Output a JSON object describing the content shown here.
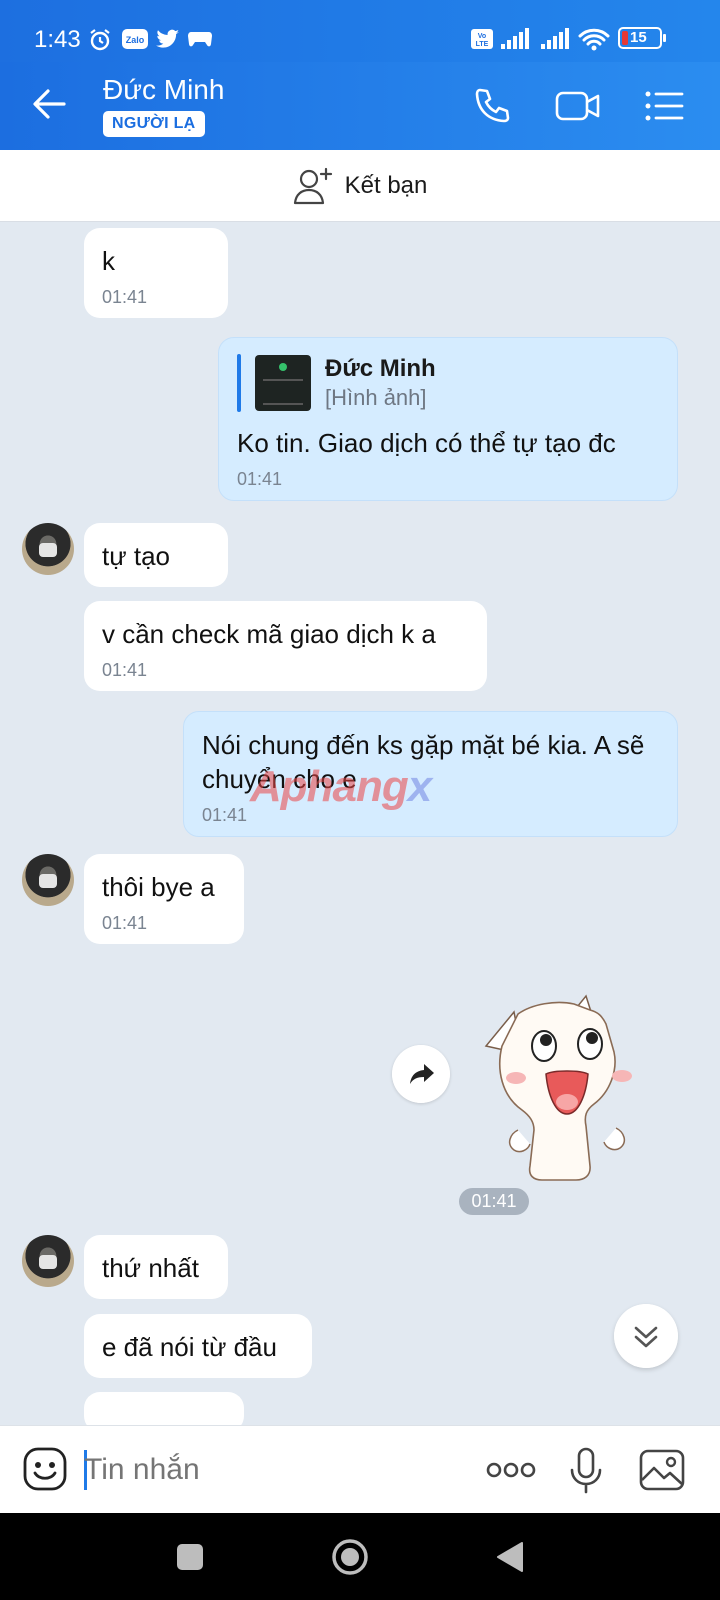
{
  "status_bar": {
    "time": "1:43",
    "battery": "15",
    "icons": [
      "alarm-icon",
      "zalo-icon",
      "twitter-icon",
      "game-icon",
      "volte-icon",
      "signal-icon",
      "signal-icon",
      "wifi-icon",
      "battery-icon"
    ]
  },
  "header": {
    "contact_name": "Đức Minh",
    "badge": "NGƯỜI LẠ",
    "icons": [
      "back-arrow-icon",
      "phone-icon",
      "video-call-icon",
      "menu-list-icon"
    ]
  },
  "add_friend": {
    "label": "Kết bạn",
    "icon": "add-user-icon"
  },
  "messages": [
    {
      "dir": "in",
      "text": "k",
      "time": "01:41"
    },
    {
      "dir": "out",
      "quote_name": "Đức Minh",
      "quote_type": "[Hình ảnh]",
      "text": "Ko tin. Giao dịch có thể tự tạo đc",
      "time": "01:41"
    },
    {
      "dir": "in",
      "text": "tự tạo"
    },
    {
      "dir": "in",
      "text": "v cần check mã giao dịch k a",
      "time": "01:41"
    },
    {
      "dir": "out",
      "text": "Nói chung đến ks gặp mặt bé kia. A sẽ chuyển cho e",
      "time": "01:41"
    },
    {
      "dir": "in",
      "text": "thôi bye a",
      "time": "01:41"
    },
    {
      "dir": "out",
      "sticker": "cat-sticker",
      "time": "01:41"
    },
    {
      "dir": "in",
      "text": "thứ nhất"
    },
    {
      "dir": "in",
      "text": "e đã nói từ đầu"
    }
  ],
  "watermark": {
    "part1": "Aphang",
    "part2": "x"
  },
  "input_bar": {
    "placeholder": "Tin nhắn",
    "icons": [
      "emoji-icon",
      "more-dots-icon",
      "microphone-icon",
      "image-icon"
    ]
  },
  "colors": {
    "header_blue": "#1c6ee0",
    "out_bubble": "#d5ecff",
    "chat_bg": "#e2e9f1"
  }
}
